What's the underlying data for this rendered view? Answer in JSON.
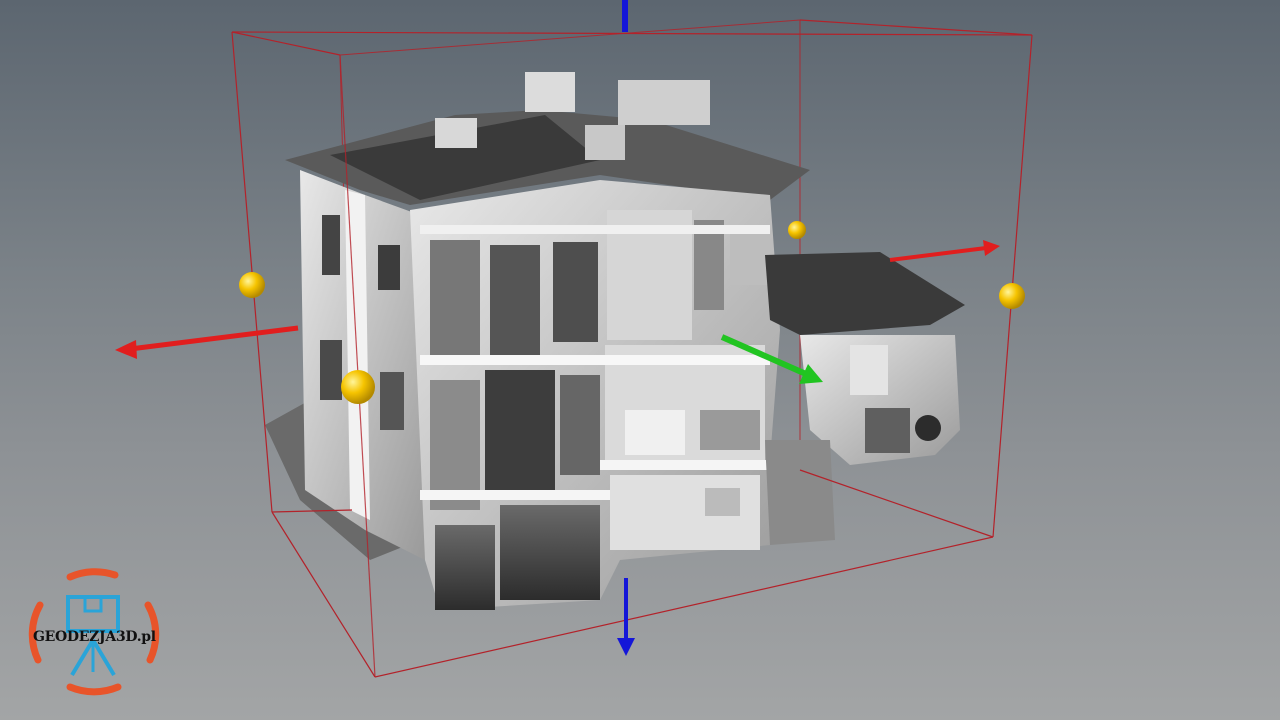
{
  "viewer": {
    "scene": "point-cloud-building-section",
    "colors": {
      "clip_box": "#b3222a",
      "axis_x": "#e11e1e",
      "axis_y": "#21c421",
      "axis_z": "#1416d8",
      "handle": "#f6c400"
    },
    "icons": [
      "x-axis-arrow-icon",
      "y-axis-arrow-icon",
      "z-axis-arrow-icon",
      "resize-handle-icon"
    ]
  },
  "watermark": {
    "text": "GEODEZJA3D.pl",
    "colors": {
      "ring": "#e8542a",
      "camera": "#2aa4d8"
    },
    "icon": "scanner-camera-icon"
  }
}
